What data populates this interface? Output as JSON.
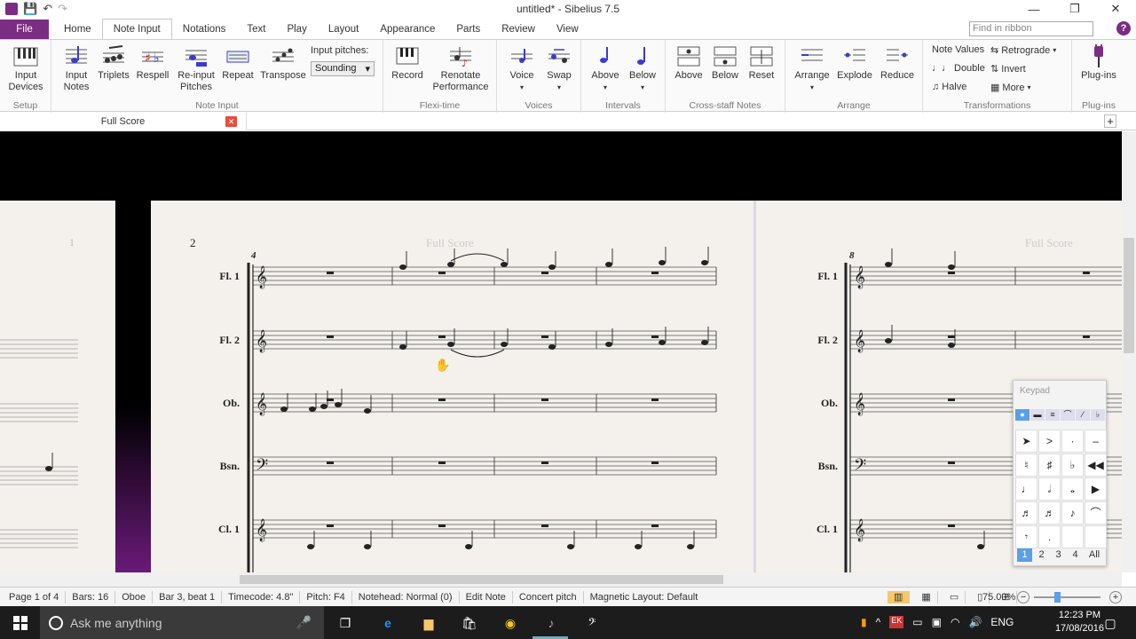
{
  "window": {
    "title": "untitled* - Sibelius 7.5"
  },
  "tabs": [
    "File",
    "Home",
    "Note Input",
    "Notations",
    "Text",
    "Play",
    "Layout",
    "Appearance",
    "Parts",
    "Review",
    "View"
  ],
  "active_tab": "Note Input",
  "find": {
    "placeholder": "Find in ribbon"
  },
  "ribbon": {
    "setup": {
      "label": "Setup",
      "input_devices": "Input Devices"
    },
    "note_input": {
      "label": "Note Input",
      "input_notes": "Input Notes",
      "triplets": "Triplets",
      "respell": "Respell",
      "reinput": "Re-input Pitches",
      "repeat": "Repeat",
      "transpose": "Transpose",
      "input_pitches": "Input pitches:",
      "sounding": "Sounding"
    },
    "flexi": {
      "label": "Flexi-time",
      "record": "Record",
      "renotate": "Renotate Performance"
    },
    "voices": {
      "label": "Voices",
      "voice": "Voice",
      "swap": "Swap"
    },
    "intervals": {
      "label": "Intervals",
      "above": "Above",
      "below": "Below"
    },
    "cross": {
      "label": "Cross-staff Notes",
      "above": "Above",
      "below": "Below",
      "reset": "Reset"
    },
    "arrange": {
      "label": "Arrange",
      "arrange": "Arrange",
      "explode": "Explode",
      "reduce": "Reduce"
    },
    "transform": {
      "label": "Transformations",
      "note_values": "Note Values",
      "double": "Double",
      "halve": "Halve",
      "retrograde": "Retrograde",
      "invert": "Invert",
      "more": "More"
    },
    "plugins": {
      "label": "Plug-ins",
      "plugins": "Plug-ins"
    }
  },
  "doc_tab": "Full Score",
  "score": {
    "page_numbers": [
      "1",
      "2"
    ],
    "header": "Full Score",
    "bar_numbers": [
      "4",
      "8"
    ],
    "instruments": [
      "Fl. 1",
      "Fl. 2",
      "Ob.",
      "Bsn.",
      "Cl. 1"
    ]
  },
  "keypad": {
    "title": "Keypad",
    "layouts": [
      "1",
      "2",
      "3",
      "4",
      "All"
    ]
  },
  "status": [
    "Page 1 of 4",
    "Bars: 16",
    "Oboe",
    "Bar 3, beat 1",
    "Timecode: 4.8\"",
    "Pitch: F4",
    "Notehead: Normal (0)",
    "Edit Note",
    "Concert pitch",
    "Magnetic Layout: Default"
  ],
  "zoom": "75.00%",
  "taskbar": {
    "search": "Ask me anything",
    "time": "12:23 PM",
    "date": "17/08/2016",
    "lang": "ENG"
  },
  "colors": {
    "brand": "#7b2d83"
  }
}
